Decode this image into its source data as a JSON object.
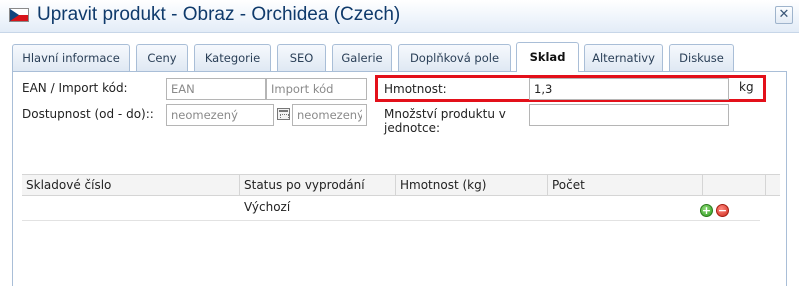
{
  "window": {
    "title": "Upravit produkt - Obraz - Orchidea (Czech)",
    "close_symbol": "✕",
    "flag_icon": "czech-flag-icon"
  },
  "tabs": [
    {
      "label": "Hlavní informace",
      "active": false
    },
    {
      "label": "Ceny",
      "active": false
    },
    {
      "label": "Kategorie",
      "active": false
    },
    {
      "label": "SEO",
      "active": false
    },
    {
      "label": "Galerie",
      "active": false
    },
    {
      "label": "Doplňková pole",
      "active": false
    },
    {
      "label": "Sklad",
      "active": true
    },
    {
      "label": "Alternativy",
      "active": false
    },
    {
      "label": "Diskuse",
      "active": false
    }
  ],
  "form": {
    "ean_label": "EAN / Import kód:",
    "ean_placeholder": "EAN",
    "import_placeholder": "Import kód",
    "availability_label": "Dostupnost (od - do)::",
    "from_placeholder": "neomezený",
    "to_placeholder": "neomezený",
    "weight_label": "Hmotnost:",
    "weight_value": "1,3",
    "weight_unit": "kg",
    "quantity_label_line1": "Množství produktu v",
    "quantity_label_line2": "jednotce:",
    "quantity_value": ""
  },
  "stock_table": {
    "columns": [
      "Skladové číslo",
      "Status po vyprodání",
      "Hmotnost (kg)",
      "Počet"
    ],
    "rows": [
      {
        "sku": "",
        "status": "Výchozí",
        "weight": "",
        "count": ""
      }
    ],
    "add_symbol": "+",
    "remove_symbol": "−"
  },
  "colors": {
    "highlight": "#e3101a",
    "title_text": "#0f3a6b",
    "tab_border": "#a9bed7"
  }
}
